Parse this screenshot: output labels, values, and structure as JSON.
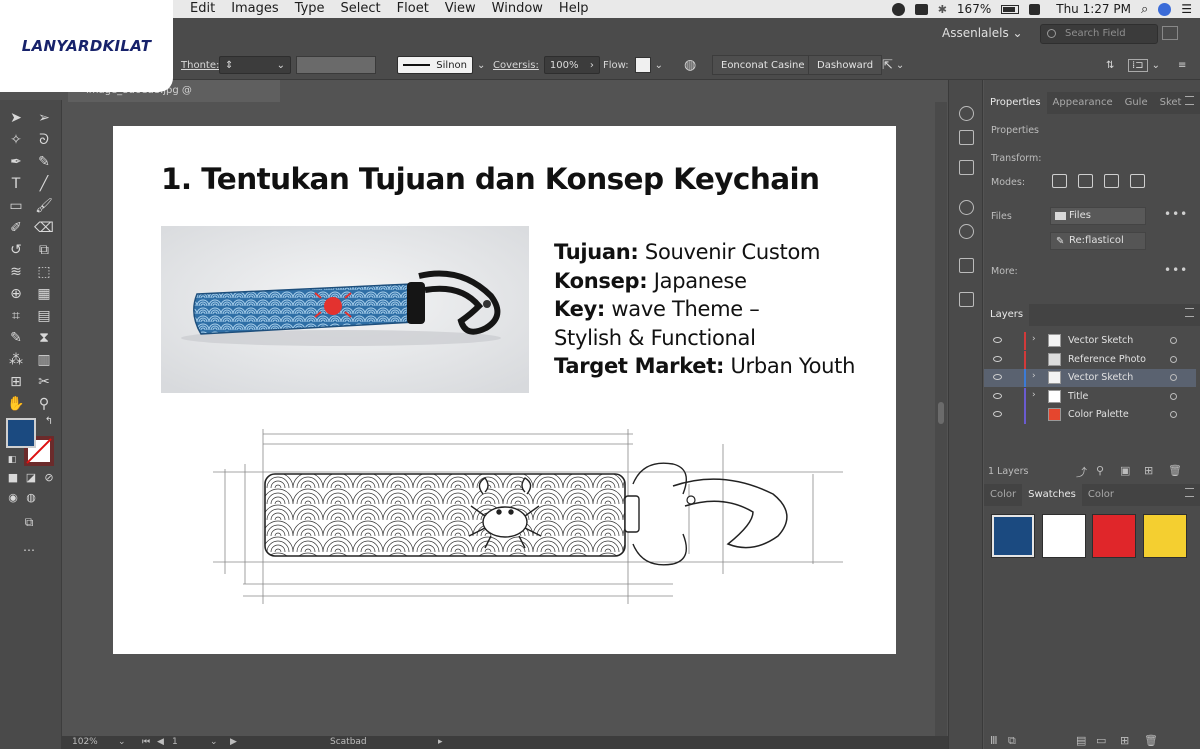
{
  "menubar": {
    "items": [
      "Edit",
      "Images",
      "Type",
      "Select",
      "Floet",
      "View",
      "Window",
      "Help"
    ],
    "battery": "167%",
    "clock": "Thu 1:27 PM"
  },
  "logo": {
    "text": "LANYARDKILAT"
  },
  "workspace": {
    "label": "Assenlalels",
    "search_placeholder": "Search Field"
  },
  "options": {
    "thonte_label": "Thonte:",
    "stroke_label": "Silnon",
    "coversis_label": "Coversis:",
    "coversis_value": "100%",
    "flow_label": "Flow:",
    "btn1": "Eonconat Casine",
    "btn2": "Dashoward"
  },
  "doc_tab": {
    "title": "image_8d6ed8.jpg @ image_8d6ed8.jpg"
  },
  "artboard": {
    "title": "1. Tentukan Tujuan dan Konsep Keychain",
    "lines": [
      {
        "bold": "Tujuan:",
        "normal": " Souvenir Custom"
      },
      {
        "bold": "Konsep:",
        "normal": " Japanese"
      },
      {
        "bold": "Key:",
        "normal": " wave Theme –"
      },
      {
        "bold": "",
        "normal": "Stylish & Functional"
      },
      {
        "bold": "Target Market:",
        "normal": " Urban Youth"
      }
    ]
  },
  "statusbar": {
    "zoom": "102%",
    "page": "1",
    "tool": "Scatbad"
  },
  "properties_panel": {
    "tabs": [
      "Properties",
      "Appearance",
      "Gule",
      "Sket"
    ],
    "section": "Properties",
    "transform_label": "Transform:",
    "modes_label": "Modes:",
    "files_label": "Files",
    "files_button": "Files",
    "reflast_button": "Re:flasticol",
    "more_label": "More:"
  },
  "layers_panel": {
    "title": "Layers",
    "count_label": "1 Layers",
    "layers": [
      {
        "name": "Vector Sketch",
        "color": "#d23a3a",
        "has_arrow": true,
        "thumb": "#f3f3f3",
        "selected": false
      },
      {
        "name": "Reference Photo",
        "color": "#d23a3a",
        "has_arrow": false,
        "thumb": "#dcdcdc",
        "selected": false
      },
      {
        "name": "Vector Sketch",
        "color": "#3b7bd6",
        "has_arrow": true,
        "thumb": "#f3f3f3",
        "selected": true
      },
      {
        "name": "Title",
        "color": "#6a5bd0",
        "has_arrow": true,
        "thumb": "#ffffff",
        "selected": false
      },
      {
        "name": "Color Palette",
        "color": "#6a5bd0",
        "has_arrow": false,
        "thumb": "#e5462e",
        "selected": false
      }
    ]
  },
  "swatches_panel": {
    "tabs": [
      "Color",
      "Swatches",
      "Color"
    ],
    "colors": [
      "#1b4a80",
      "#ffffff",
      "#e0262a",
      "#f4cf30"
    ]
  }
}
